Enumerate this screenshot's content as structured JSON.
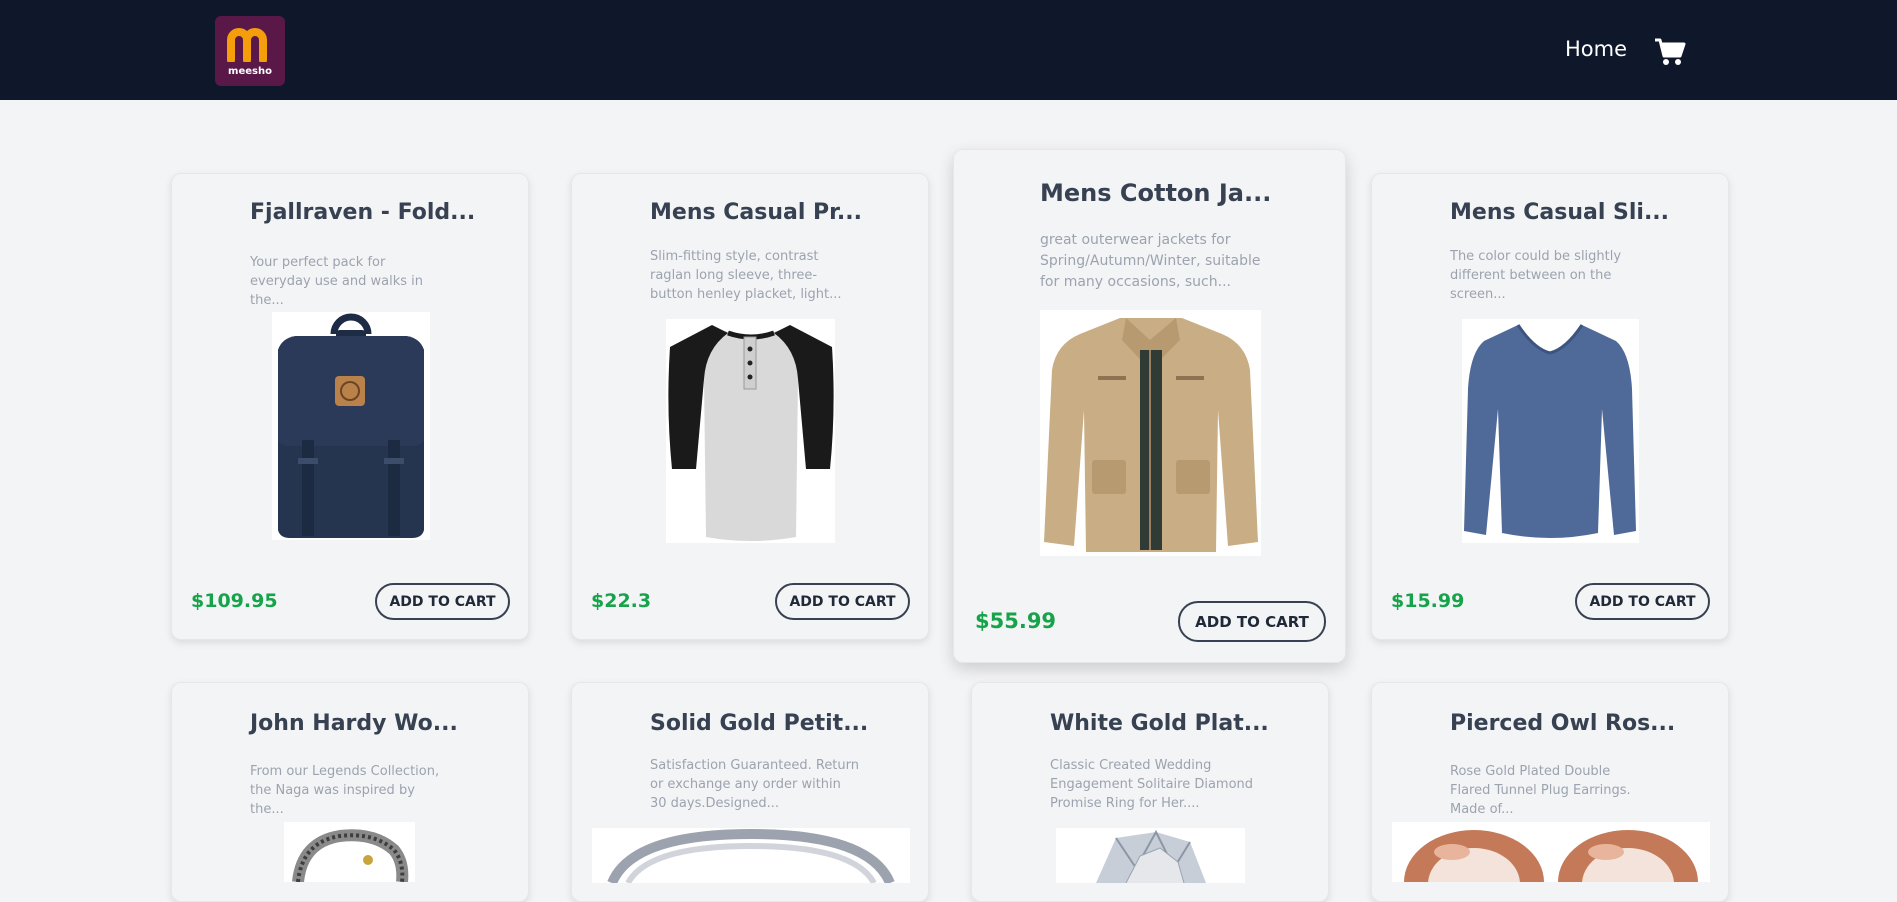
{
  "navbar": {
    "logo_text": "meesho",
    "home_label": "Home",
    "cart_icon": "cart-icon"
  },
  "colors": {
    "nav_bg": "#0f172a",
    "page_bg": "#f3f4f6",
    "price": "#16a34a",
    "logo_bg": "#5a1849",
    "logo_m": "#f59e0b"
  },
  "products": [
    {
      "title": "Fjallraven - Fold...",
      "description": "Your perfect pack for everyday use and walks in the...",
      "price": "$109.95",
      "button": "ADD TO CART",
      "image": "backpack"
    },
    {
      "title": "Mens Casual Pr...",
      "description": "Slim-fitting style, contrast raglan long sleeve, three-button henley placket, light...",
      "price": "$22.3",
      "button": "ADD TO CART",
      "image": "raglan-tshirt"
    },
    {
      "title": "Mens Cotton Ja...",
      "description": "great outerwear jackets for Spring/Autumn/Winter, suitable for many occasions, such...",
      "price": "$55.99",
      "button": "ADD TO CART",
      "image": "cotton-jacket"
    },
    {
      "title": "Mens Casual Sli...",
      "description": "The color could be slightly different between on the screen...",
      "price": "$15.99",
      "button": "ADD TO CART",
      "image": "slim-fit-shirt"
    },
    {
      "title": "John Hardy Wo...",
      "description": "From our Legends Collection, the Naga was inspired by the...",
      "image": "dragon-bracelet"
    },
    {
      "title": "Solid Gold Petit...",
      "description": "Satisfaction Guaranteed. Return or exchange any order within 30 days.Designed...",
      "image": "gold-bangle"
    },
    {
      "title": "White Gold Plat...",
      "description": "Classic Created Wedding Engagement Solitaire Diamond Promise Ring for Her....",
      "image": "diamond-ring"
    },
    {
      "title": "Pierced Owl Ros...",
      "description": "Rose Gold Plated Double Flared Tunnel Plug Earrings. Made of...",
      "image": "tunnel-plugs"
    }
  ]
}
